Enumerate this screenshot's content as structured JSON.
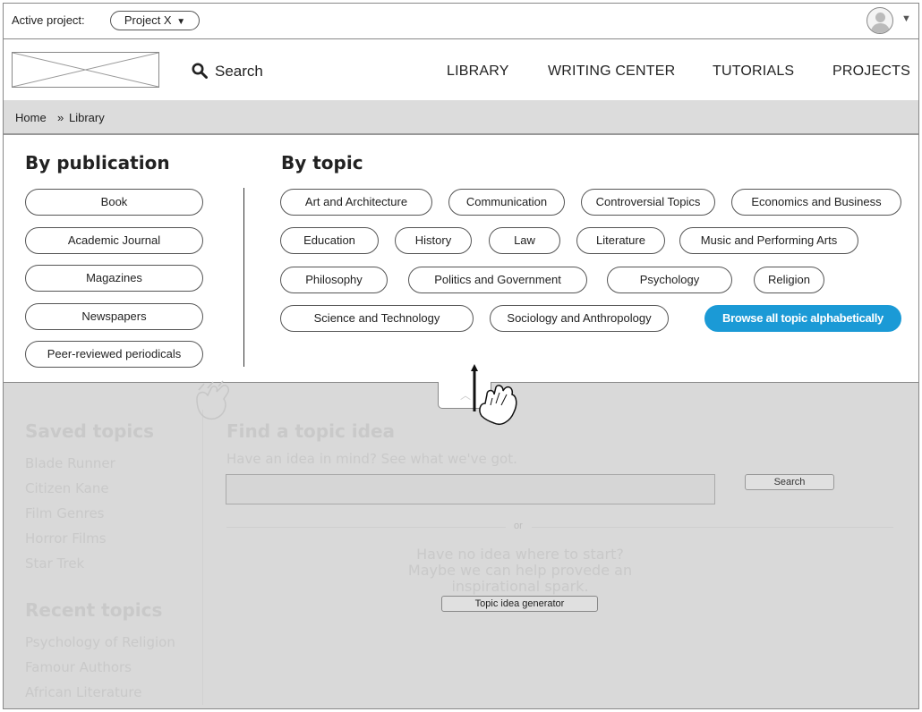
{
  "topbar": {
    "active_label": "Active project:",
    "project_value": "Project X",
    "project_caret": "▼",
    "avatar_caret": "▼"
  },
  "header": {
    "search_label": "Search",
    "nav": [
      "LIBRARY",
      "WRITING CENTER",
      "TUTORIALS",
      "PROJECTS"
    ]
  },
  "breadcrumb": {
    "home": "Home",
    "separator": "»",
    "current": "Library"
  },
  "panel": {
    "by_publication_title": "By publication",
    "publications": [
      "Book",
      "Academic Journal",
      "Magazines",
      "Newspapers",
      "Peer-reviewed periodicals"
    ],
    "by_topic_title": "By topic",
    "topics": [
      "Art and Architecture",
      "Communication",
      "Controversial Topics",
      "Economics and Business",
      "Education",
      "History",
      "Law",
      "Literature",
      "Music and Performing Arts",
      "Philosophy",
      "Politics and Government",
      "Psychology",
      "Religion",
      "Science and Technology",
      "Sociology and Anthropology"
    ],
    "browse_all_label": "Browse all topic alphabetically",
    "accent_color": "#1b9ad6"
  },
  "background": {
    "saved_title": "Saved topics",
    "saved_items": [
      "Blade Runner",
      "Citizen Kane",
      "Film Genres",
      "Horror Films",
      "Star Trek"
    ],
    "recent_title": "Recent topics",
    "recent_items": [
      "Psychology of Religion",
      "Famour Authors",
      "African Literature"
    ],
    "find_title": "Find a topic idea",
    "find_subtitle": "Have an idea in mind? See what we've got.",
    "search_button": "Search",
    "or_label": "or",
    "no_idea_line1": "Have no idea where to start?",
    "no_idea_line2": "Maybe we can help provede an inspirational spark.",
    "generator_button": "Topic idea generator"
  },
  "icons": {
    "search": "search-icon",
    "avatar": "user-avatar-icon",
    "collapse": "chevron-up-icon",
    "gesture": "hand-swipe-up-icon"
  }
}
